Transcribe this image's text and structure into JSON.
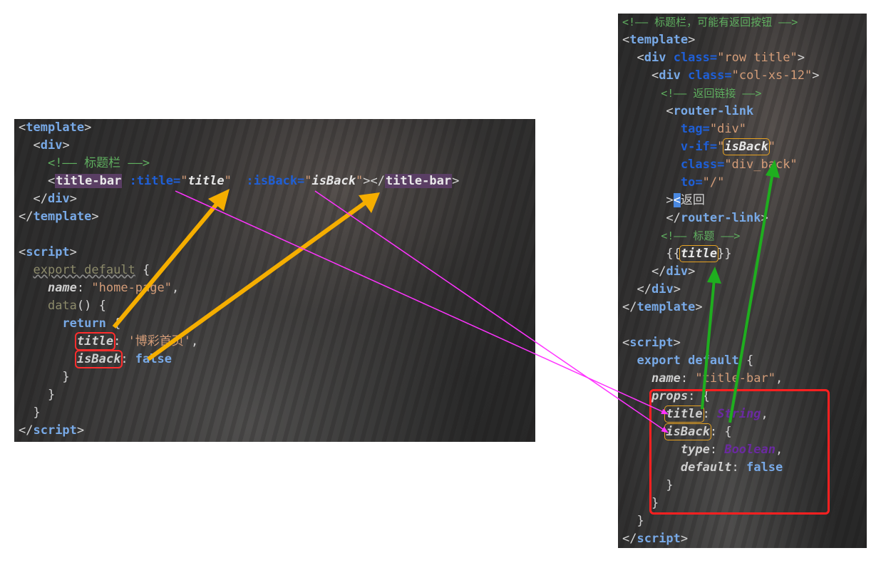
{
  "left_code": {
    "l1_open": "<",
    "l1_tag": "template",
    "l1_close": ">",
    "l2_open": "<",
    "l2_tag": "div",
    "l2_close": ">",
    "l3_comment": "<!—— 标题栏 ——>",
    "l4_open": "<",
    "l4_tag": "title-bar",
    "l4_attr1": ":title=",
    "l4_q1": "\"",
    "l4_val1": "title",
    "l4_q2": "\"",
    "l4_attr2": ":isBack=",
    "l4_q3": "\"",
    "l4_val2": "isBack",
    "l4_q4": "\"",
    "l4_mid": "></",
    "l4_tag2": "title-bar",
    "l4_end": ">",
    "l5_open": "</",
    "l5_tag": "div",
    "l5_close": ">",
    "l6_open": "</",
    "l6_tag": "template",
    "l6_close": ">",
    "l8_open": "<",
    "l8_tag": "script",
    "l8_close": ">",
    "l9_kw": "export default",
    "l9_rest": " {",
    "l10_key": "name",
    "l10_colon": ": ",
    "l10_val": "\"home-page\"",
    "l10_comma": ",",
    "l11_fn": "data",
    "l11_rest": "() {",
    "l12_kw": "return",
    "l12_rest": " {",
    "l13_key": "title",
    "l13_colon": ": ",
    "l13_val": "'博彩首页'",
    "l13_comma": ",",
    "l14_key": "isBack",
    "l14_colon": ": ",
    "l14_val": "false",
    "l15": "}",
    "l16": "}",
    "l17": "}",
    "l18_open": "</",
    "l18_tag": "script",
    "l18_close": ">"
  },
  "right_code": {
    "r1_comment": "<!—— 标题栏，可能有返回按钮 ——>",
    "r2_open": "<",
    "r2_tag": "template",
    "r2_close": ">",
    "r3_open": "<",
    "r3_tag": "div",
    "r3_attr": "class=",
    "r3_val": "\"row title\"",
    "r3_close": ">",
    "r4_open": "<",
    "r4_tag": "div",
    "r4_attr": "class=",
    "r4_val": "\"col-xs-12\"",
    "r4_close": ">",
    "r5_comment": "<!—— 返回链接 ——>",
    "r6_open": "<",
    "r6_tag": "router-link",
    "r7_attr": "tag=",
    "r7_val": "\"div\"",
    "r8_attr": "v-if=",
    "r8_q1": "\"",
    "r8_var": "isBack",
    "r8_q2": "\"",
    "r9_attr": "class=",
    "r9_val": "\"div_back\"",
    "r10_attr": "to=",
    "r10_val": "\"/\"",
    "r11_gt": ">",
    "r11_lt": "<",
    "r11_text": "返回",
    "r12_open": "</",
    "r12_tag": "router-link",
    "r12_close": ">",
    "r13_comment": "<!—— 标题 ——>",
    "r14_open": "{{",
    "r14_var": "title",
    "r14_close": "}}",
    "r15_open": "</",
    "r15_tag": "div",
    "r15_close": ">",
    "r16_open": "</",
    "r16_tag": "div",
    "r16_close": ">",
    "r17_open": "</",
    "r17_tag": "template",
    "r17_close": ">",
    "r19_open": "<",
    "r19_tag": "script",
    "r19_close": ">",
    "r20_kw": "export default",
    "r20_rest": " {",
    "r21_key": "name",
    "r21_colon": ": ",
    "r21_val": "\"title-bar\"",
    "r21_comma": ",",
    "r22_key": "props",
    "r22_rest": ": {",
    "r23_key": "title",
    "r23_colon": ": ",
    "r23_type": "String",
    "r23_comma": ",",
    "r24_key": "isBack",
    "r24_rest": ": {",
    "r25_key": "type",
    "r25_colon": ": ",
    "r25_type": "Boolean",
    "r25_comma": ",",
    "r26_key": "default",
    "r26_colon": ": ",
    "r26_val": "false",
    "r27": "}",
    "r28": "}",
    "r29": "}",
    "r30_open": "</",
    "r30_tag": "script",
    "r30_close": ">"
  },
  "arrow_colors": {
    "orange": "#f5ae00",
    "magenta": "#ff33ff",
    "green": "#1fae1f",
    "red_box": "#ff2020"
  }
}
